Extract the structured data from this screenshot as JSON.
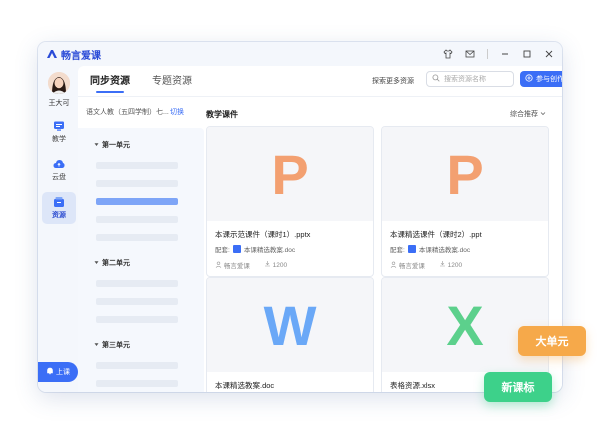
{
  "app": {
    "name": "畅言爱课",
    "brand_color": "#2a4bd7",
    "accent": "#3b6ef6"
  },
  "titlebar": {
    "icons": [
      "shirt-icon",
      "mail-icon",
      "minimize-icon",
      "maximize-icon",
      "close-icon"
    ]
  },
  "user": {
    "name": "王大可"
  },
  "sidebar": {
    "items": [
      {
        "label": "教学",
        "icon": "teach-icon",
        "active": false
      },
      {
        "label": "云盘",
        "icon": "cloud-icon",
        "active": false
      },
      {
        "label": "资源",
        "icon": "resource-icon",
        "active": true
      }
    ],
    "upload_label": "上课"
  },
  "header": {
    "tabs": [
      {
        "label": "同步资源",
        "active": true
      },
      {
        "label": "专题资源",
        "active": false
      }
    ],
    "explore_label": "探索更多资源",
    "search_placeholder": "搜索资源名称",
    "join_label": "参与创作＋计划"
  },
  "left_panel": {
    "edition": "语文人教（五四学制）七...",
    "switch_label": "切换",
    "units": [
      {
        "title": "第一单元"
      },
      {
        "title": "第二单元"
      },
      {
        "title": "第三单元"
      }
    ]
  },
  "main": {
    "section_title": "教学课件",
    "sort_label": "综合推荐",
    "cards": [
      {
        "letter": "P",
        "letter_color": "#f3a071",
        "title": "本课示范课件（课时1）.pptx",
        "sub_prefix": "配套:",
        "sub_doc": "本课精选教案.doc",
        "author": "畅言爱课",
        "downloads": "1200"
      },
      {
        "letter": "P",
        "letter_color": "#f3a071",
        "title": "本课精选课件（课时2）.ppt",
        "sub_prefix": "配套:",
        "sub_doc": "本课精选教案.doc",
        "author": "畅言爱课",
        "downloads": "1200"
      },
      {
        "letter": "W",
        "letter_color": "#6aa8f7",
        "title": "本课精选教案.doc"
      },
      {
        "letter": "X",
        "letter_color": "#5cd08c",
        "title": "表格资源.xlsx"
      }
    ]
  },
  "tags": [
    {
      "label": "大单元",
      "color": "#f6a94a"
    },
    {
      "label": "新课标",
      "color": "#3dd18a"
    }
  ]
}
